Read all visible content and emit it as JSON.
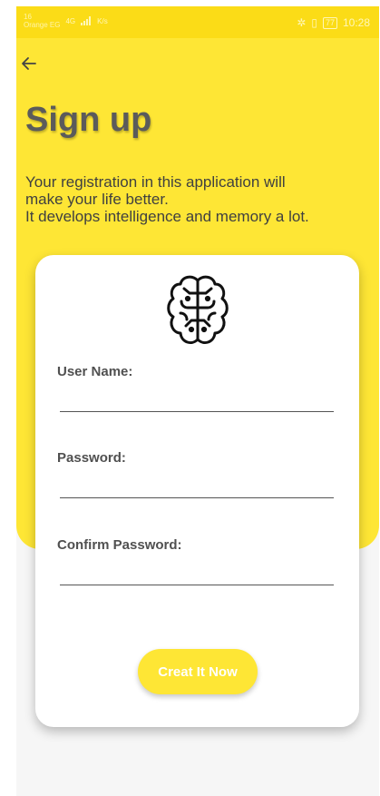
{
  "status_bar": {
    "carrier": "Orange EG",
    "carrier_top": "16",
    "network": "4G",
    "speed": "K/s",
    "battery": "77",
    "time": "10:28"
  },
  "app_bar": {
    "back_icon": "arrow-left-icon"
  },
  "page": {
    "title": "Sign up",
    "description_lines": [
      "Your registration in this application will",
      "make your life better.",
      "It develops intelligence and memory a lot."
    ]
  },
  "form": {
    "logo_icon": "brain-icon",
    "username_label": "User Name:",
    "username_value": "",
    "password_label": "Password:",
    "password_value": "",
    "confirm_label": "Confirm Password:",
    "confirm_value": "",
    "submit_label": "Creat It Now"
  },
  "colors": {
    "primary": "#fee635",
    "status_bar": "#fbdc17",
    "title_text": "#5b5b5b",
    "button_text": "#ffffff"
  }
}
